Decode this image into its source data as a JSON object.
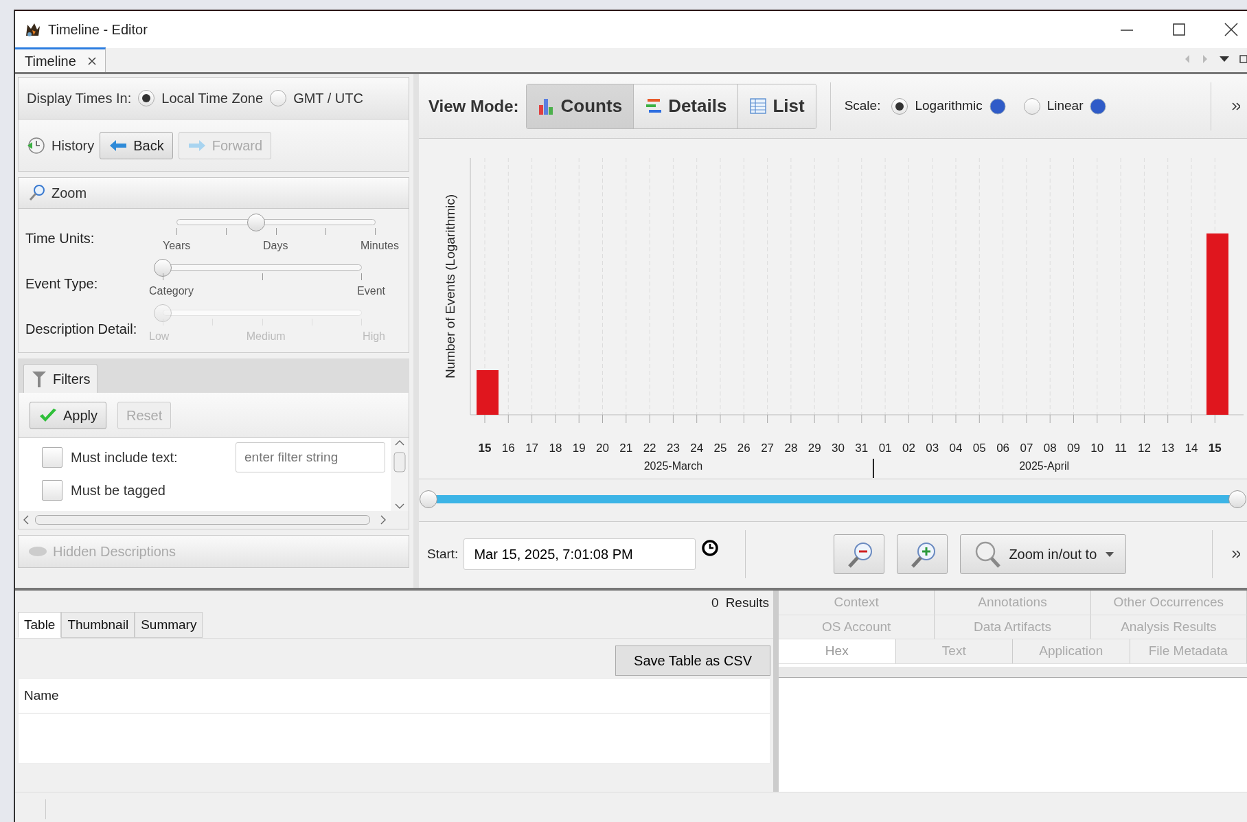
{
  "window": {
    "title": "Timeline - Editor"
  },
  "document_tabs": [
    {
      "label": "Timeline",
      "selected": true
    }
  ],
  "display_times": {
    "label": "Display Times In:",
    "options": [
      {
        "label": "Local Time Zone",
        "selected": true
      },
      {
        "label": "GMT / UTC",
        "selected": false
      }
    ]
  },
  "history": {
    "label": "History",
    "buttons": [
      {
        "label": "Back",
        "disabled": false
      },
      {
        "label": "Forward",
        "disabled": true
      }
    ]
  },
  "zoom": {
    "title": "Zoom",
    "sliders": [
      {
        "label": "Time Units:",
        "level": 0.4,
        "disabled": false,
        "tick_labels": [
          "Years",
          "Days",
          "Minutes"
        ]
      },
      {
        "label": "Event Type:",
        "level": 0,
        "disabled": false,
        "tick_labels": [
          "Category",
          "Event"
        ]
      },
      {
        "label": "Description Detail:",
        "level": 0,
        "disabled": true,
        "tick_labels": [
          "Low",
          "Medium",
          "High"
        ]
      }
    ]
  },
  "filters": {
    "tab": "Filters",
    "buttons": [
      {
        "label": "Apply",
        "disabled": false
      },
      {
        "label": "Reset",
        "disabled": true
      }
    ],
    "items": [
      {
        "label": "Must include text:",
        "checked": false,
        "placeholder": "enter filter string"
      },
      {
        "label": "Must be tagged",
        "checked": false
      }
    ]
  },
  "hidden_descriptions": {
    "label": "Hidden Descriptions",
    "disabled": true
  },
  "view_mode": {
    "label": "View Mode:",
    "modes": [
      {
        "label": "Counts",
        "selected": true
      },
      {
        "label": "Details",
        "selected": false
      },
      {
        "label": "List",
        "selected": false
      }
    ],
    "scale_label": "Scale:",
    "scales": [
      {
        "label": "Logarithmic",
        "selected": true
      },
      {
        "label": "Linear",
        "selected": false
      }
    ]
  },
  "chart": {
    "ylabel": "Number of Events (Logarithmic)",
    "days": [
      {
        "label": "15",
        "bold": true
      },
      {
        "label": "16",
        "bold": false
      },
      {
        "label": "17",
        "bold": false
      },
      {
        "label": "18",
        "bold": false
      },
      {
        "label": "19",
        "bold": false
      },
      {
        "label": "20",
        "bold": false
      },
      {
        "label": "21",
        "bold": false
      },
      {
        "label": "22",
        "bold": false
      },
      {
        "label": "23",
        "bold": false
      },
      {
        "label": "24",
        "bold": false
      },
      {
        "label": "25",
        "bold": false
      },
      {
        "label": "26",
        "bold": false
      },
      {
        "label": "27",
        "bold": false
      },
      {
        "label": "28",
        "bold": false
      },
      {
        "label": "29",
        "bold": false
      },
      {
        "label": "30",
        "bold": false
      },
      {
        "label": "31",
        "bold": false
      },
      {
        "label": "01",
        "bold": false
      },
      {
        "label": "02",
        "bold": false
      },
      {
        "label": "03",
        "bold": false
      },
      {
        "label": "04",
        "bold": false
      },
      {
        "label": "05",
        "bold": false
      },
      {
        "label": "06",
        "bold": false
      },
      {
        "label": "07",
        "bold": false
      },
      {
        "label": "08",
        "bold": false
      },
      {
        "label": "09",
        "bold": false
      },
      {
        "label": "10",
        "bold": false
      },
      {
        "label": "11",
        "bold": false
      },
      {
        "label": "12",
        "bold": false
      },
      {
        "label": "13",
        "bold": false
      },
      {
        "label": "14",
        "bold": false
      },
      {
        "label": "15",
        "bold": true
      }
    ],
    "months": [
      "2025-March",
      "2025-April"
    ]
  },
  "range_slider": {
    "level": 1
  },
  "start": {
    "label": "Start:",
    "value": "Mar 15, 2025, 7:01:08 PM"
  },
  "zoom_dropdown": {
    "label": "Zoom in/out to"
  },
  "results": {
    "count": "0",
    "label": "Results",
    "tabs": [
      {
        "label": "Table",
        "selected": true
      },
      {
        "label": "Thumbnail",
        "selected": false
      },
      {
        "label": "Summary",
        "selected": false
      }
    ],
    "save_button": "Save Table as CSV",
    "columns": [
      "Name"
    ]
  },
  "content_viewer": {
    "tab_rows": [
      {
        "tabs": [
          {
            "label": "Context",
            "selected": false
          },
          {
            "label": "Annotations",
            "selected": false
          },
          {
            "label": "Other Occurrences",
            "selected": false
          }
        ]
      },
      {
        "tabs": [
          {
            "label": "OS Account",
            "selected": false
          },
          {
            "label": "Data Artifacts",
            "selected": false
          },
          {
            "label": "Analysis Results",
            "selected": false
          }
        ]
      },
      {
        "tabs": [
          {
            "label": "Hex",
            "selected": true
          },
          {
            "label": "Text",
            "selected": false
          },
          {
            "label": "Application",
            "selected": false
          },
          {
            "label": "File Metadata",
            "selected": false
          }
        ]
      }
    ]
  }
}
